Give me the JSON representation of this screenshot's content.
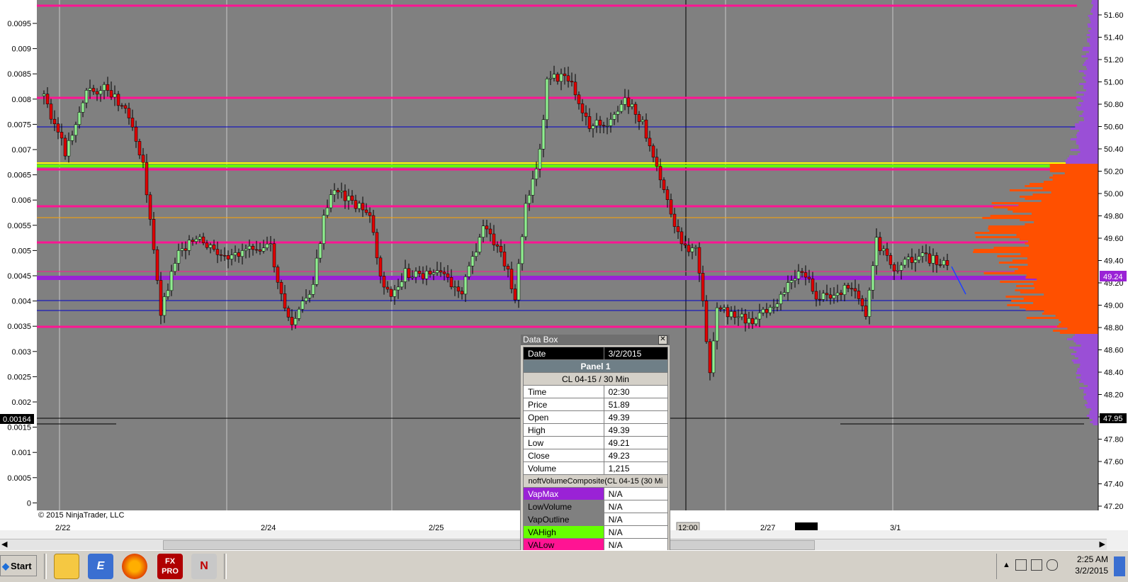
{
  "chart": {
    "copyright": "© 2015 NinjaTrader, LLC",
    "left_axis_ticks": [
      "0.0095",
      "0.009",
      "0.0085",
      "0.008",
      "0.0075",
      "0.007",
      "0.0065",
      "0.006",
      "0.0055",
      "0.005",
      "0.0045",
      "0.004",
      "0.0035",
      "0.003",
      "0.0025",
      "0.002",
      "0.0015",
      "0.001",
      "0.0005",
      "0"
    ],
    "left_axis_marker": "0.00164",
    "right_axis_ticks": [
      "51.60",
      "51.40",
      "51.20",
      "51.00",
      "50.80",
      "50.60",
      "50.40",
      "50.20",
      "50.00",
      "49.80",
      "49.60",
      "49.40",
      "49.20",
      "49.00",
      "48.80",
      "48.60",
      "48.40",
      "48.20",
      "48.00",
      "47.80",
      "47.60",
      "47.40",
      "47.20"
    ],
    "price_tag": "49.24",
    "price_tag_hidden": "49.39",
    "right_axis_marker": "47.95",
    "x_labels": [
      "2/22",
      "2/24",
      "2/25",
      "12:00",
      "2/27",
      "3/1"
    ],
    "level_colors": {
      "magenta": "#ff1493",
      "blue": "#0000c8",
      "green": "#66ff00",
      "yellow": "#ffff00",
      "purple": "#8a2be2",
      "orange": "#ff5000"
    }
  },
  "databox": {
    "title": "Data Box",
    "date_label": "Date",
    "date_value": "3/2/2015",
    "panel": "Panel 1",
    "instrument": "CL 04-15 / 30 Min",
    "rows": [
      {
        "label": "Time",
        "value": "02:30"
      },
      {
        "label": "Price",
        "value": "51.89"
      },
      {
        "label": "Open",
        "value": "49.39"
      },
      {
        "label": "High",
        "value": "49.39"
      },
      {
        "label": "Low",
        "value": "49.21"
      },
      {
        "label": "Close",
        "value": "49.23"
      },
      {
        "label": "Volume",
        "value": "1,215"
      }
    ],
    "indicator": "noftVolumeComposite(CL 04-15 (30 Mi",
    "ind_rows": [
      {
        "label": "VapMax",
        "value": "N/A",
        "color": "#9a22d6"
      },
      {
        "label": "LowVolume",
        "value": "N/A",
        "color": "#808080"
      },
      {
        "label": "VapOutline",
        "value": "N/A",
        "color": "#808080"
      },
      {
        "label": "VAHigh",
        "value": "N/A",
        "color": "#66ff00"
      },
      {
        "label": "VALow",
        "value": "N/A",
        "color": "#ff1493"
      }
    ]
  },
  "taskbar": {
    "start": "Start",
    "time": "2:25 AM",
    "date": "3/2/2015",
    "apps": [
      "folder-icon",
      "e-icon",
      "firefox-icon",
      "fxpro-icon",
      "ninja-icon"
    ]
  }
}
